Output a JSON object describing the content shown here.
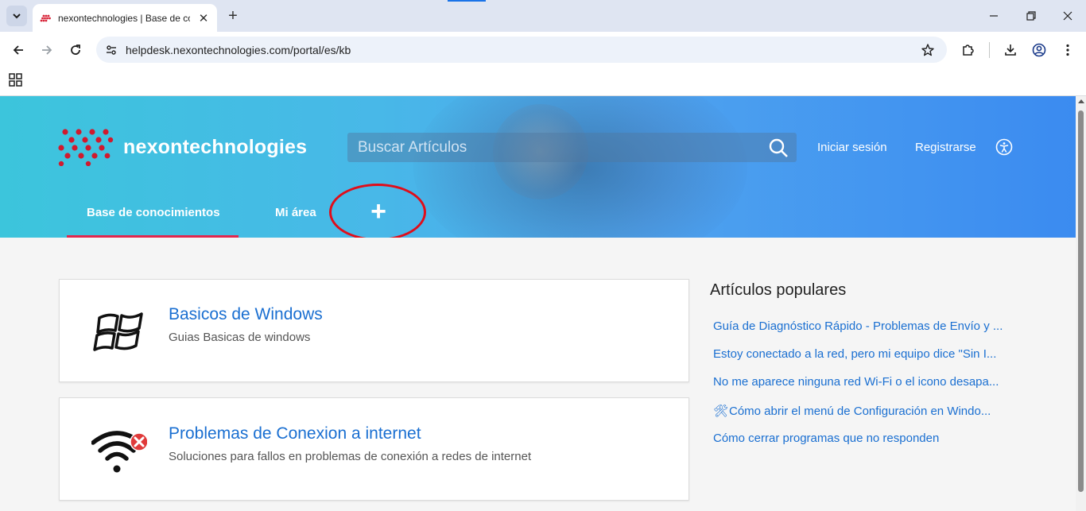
{
  "browser": {
    "tab_title": "nexontechnologies | Base de co",
    "url": "helpdesk.nexontechnologies.com/portal/es/kb"
  },
  "header": {
    "brand": "nexontechnologies",
    "search_placeholder": "Buscar Artículos",
    "login": "Iniciar sesión",
    "register": "Registrarse"
  },
  "nav": {
    "tabs": [
      {
        "label": "Base de conocimientos",
        "active": true
      },
      {
        "label": "Mi área",
        "active": false
      }
    ],
    "add_label": "+"
  },
  "categories": [
    {
      "title": "Basicos de Windows",
      "description": "Guias Basicas de windows",
      "icon": "windows-logo-icon"
    },
    {
      "title": "Problemas de Conexion a internet",
      "description": "Soluciones para fallos en problemas de conexión a redes de internet",
      "icon": "wifi-error-icon"
    }
  ],
  "popular": {
    "title": "Artículos populares",
    "items": [
      {
        "text": "Guía de Diagnóstico Rápido - Problemas de Envío y ..."
      },
      {
        "text": "Estoy conectado a la red, pero mi equipo dice \"Sin I..."
      },
      {
        "text": "No me aparece ninguna red Wi-Fi o el icono desapa..."
      },
      {
        "text": "Cómo abrir el menú de Configuración en Windo...",
        "emoji": "🛠"
      },
      {
        "text": "Cómo cerrar programas que no responden"
      }
    ]
  },
  "colors": {
    "accent": "#e2264d",
    "link": "#1a6fd1",
    "annotation": "#e00d1a"
  }
}
